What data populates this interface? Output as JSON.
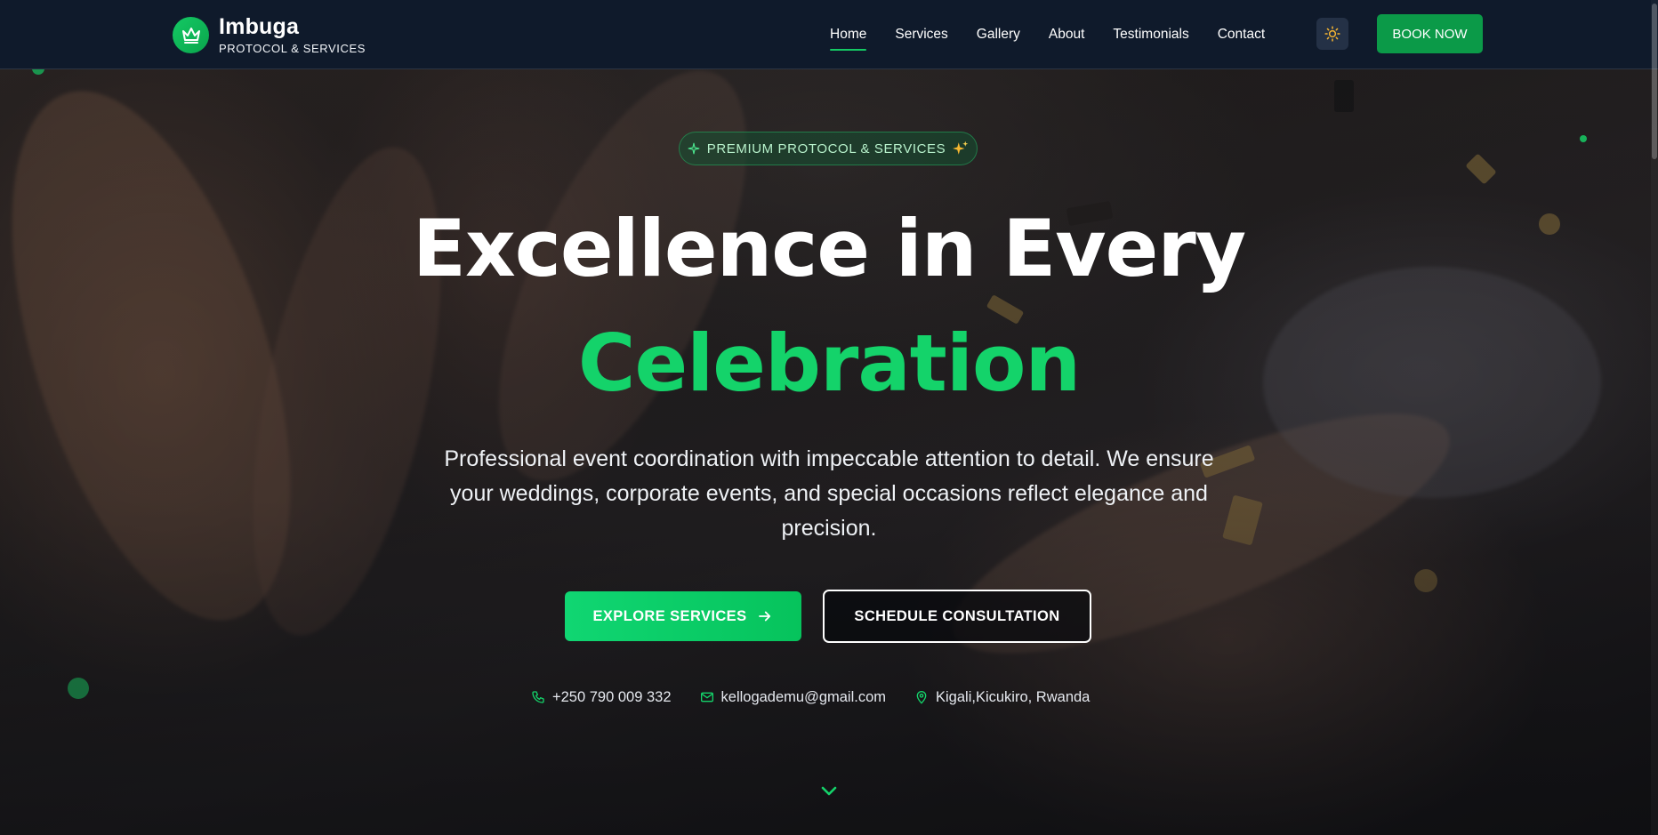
{
  "brand": {
    "name": "Imbuga",
    "subtitle": "PROTOCOL & SERVICES",
    "logo_icon": "crown-icon"
  },
  "nav": {
    "items": [
      {
        "label": "Home",
        "active": true
      },
      {
        "label": "Services",
        "active": false
      },
      {
        "label": "Gallery",
        "active": false
      },
      {
        "label": "About",
        "active": false
      },
      {
        "label": "Testimonials",
        "active": false
      },
      {
        "label": "Contact",
        "active": false
      }
    ],
    "theme_toggle_icon": "sun-icon",
    "book_label": "BOOK NOW"
  },
  "hero": {
    "badge_label": "PREMIUM PROTOCOL & SERVICES",
    "headline_line1": "Excellence in Every",
    "headline_line2": "Celebration",
    "description": "Professional event coordination with impeccable attention to detail. We ensure your weddings, corporate events, and special occasions reflect elegance and precision.",
    "primary_cta": "EXPLORE SERVICES",
    "secondary_cta": "SCHEDULE CONSULTATION"
  },
  "contact": {
    "phone": "+250 790 009 332",
    "email": "kellogademu@gmail.com",
    "location": "Kigali,Kicukiro, Rwanda"
  },
  "colors": {
    "accent": "#14D36A",
    "nav_bg": "#0F1A2B",
    "book_button": "#0B9A48"
  }
}
